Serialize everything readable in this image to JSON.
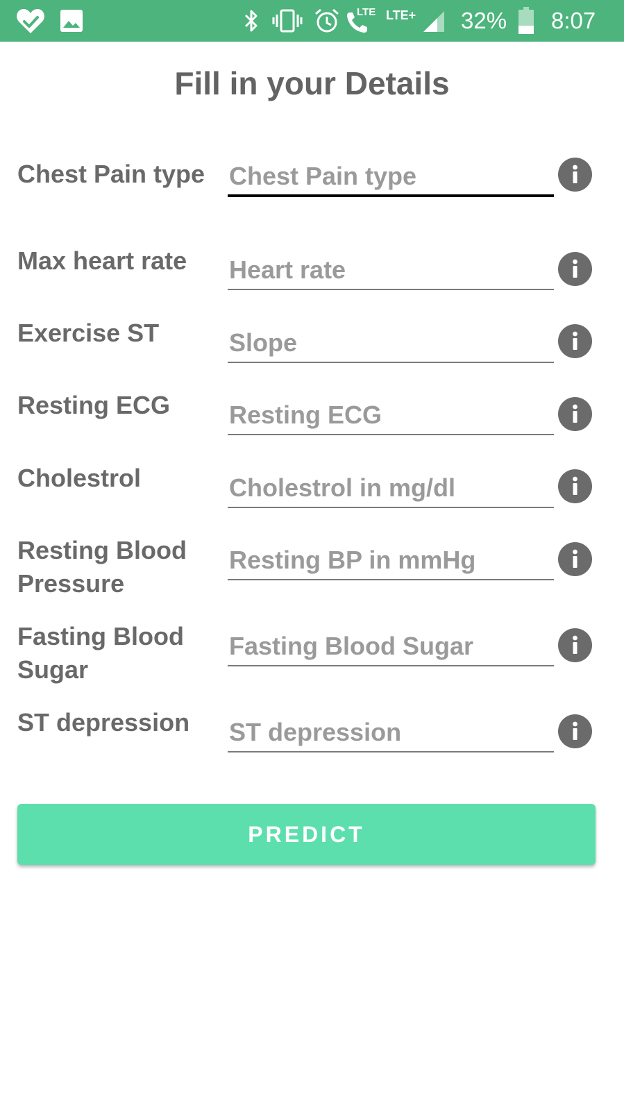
{
  "status_bar": {
    "battery": "32%",
    "time": "8:07",
    "lte_1": "LTE",
    "lte_2": "LTE+",
    "icons": [
      "heart-check-icon",
      "image-icon",
      "bluetooth-icon",
      "vibrate-icon",
      "alarm-icon",
      "wifi-calling-icon",
      "signal-icon",
      "battery-icon"
    ]
  },
  "title": "Fill in your Details",
  "fields": [
    {
      "label": "Chest Pain type",
      "placeholder": "Chest Pain type",
      "value": ""
    },
    {
      "label": "Max heart rate",
      "placeholder": "Heart rate",
      "value": ""
    },
    {
      "label": "Exercise ST",
      "placeholder": "Slope",
      "value": ""
    },
    {
      "label": "Resting ECG",
      "placeholder": "Resting ECG",
      "value": ""
    },
    {
      "label": "Cholestrol",
      "placeholder": "Cholestrol in mg/dl",
      "value": ""
    },
    {
      "label": "Resting Blood Pressure",
      "placeholder": "Resting BP in mmHg",
      "value": ""
    },
    {
      "label": "Fasting Blood Sugar",
      "placeholder": "Fasting Blood Sugar",
      "value": ""
    },
    {
      "label": "ST depression",
      "placeholder": "ST depression",
      "value": ""
    }
  ],
  "predict_label": "PREDICT",
  "colors": {
    "status_bar": "#4cb47c",
    "button": "#5ddfad",
    "text": "#696969",
    "placeholder": "#9a9a9a",
    "info_icon": "#6b6b6b"
  }
}
